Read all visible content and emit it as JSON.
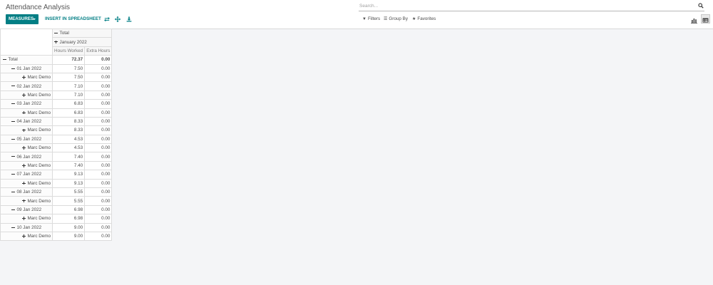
{
  "app": {
    "title": "Attendance Analysis",
    "search_placeholder": "Search..."
  },
  "toolbar": {
    "measures_label": "MEASURES",
    "spreadsheet_label": "INSERT IN SPREADSHEET",
    "icons": [
      "flip-axis-icon",
      "expand-all-icon",
      "download-icon"
    ]
  },
  "filters": {
    "filters_label": "Filters",
    "group_by_label": "Group By",
    "favorites_label": "Favorites"
  },
  "views": [
    {
      "name": "graph-view-icon",
      "active": false
    },
    {
      "name": "pivot-view-icon",
      "active": true
    }
  ],
  "pivot": {
    "col_total_label": "Total",
    "col_group_label": "January 2022",
    "measures": [
      "Hours Worked",
      "Extra Hours"
    ],
    "rows": [
      {
        "label": "Total",
        "level": 0,
        "sign": "minus",
        "hours": "72.37",
        "extra": "0.00",
        "total": true
      },
      {
        "label": "01 Jan 2022",
        "level": 1,
        "sign": "minus",
        "hours": "7.50",
        "extra": "0.00"
      },
      {
        "label": "Marc Demo",
        "level": 2,
        "sign": "plus",
        "hours": "7.50",
        "extra": "0.00"
      },
      {
        "label": "02 Jan 2022",
        "level": 1,
        "sign": "minus",
        "hours": "7.10",
        "extra": "0.00"
      },
      {
        "label": "Marc Demo",
        "level": 2,
        "sign": "plus",
        "hours": "7.10",
        "extra": "0.00"
      },
      {
        "label": "03 Jan 2022",
        "level": 1,
        "sign": "minus",
        "hours": "6.83",
        "extra": "0.00"
      },
      {
        "label": "Marc Demo",
        "level": 2,
        "sign": "plus",
        "hours": "6.83",
        "extra": "0.00"
      },
      {
        "label": "04 Jan 2022",
        "level": 1,
        "sign": "minus",
        "hours": "8.33",
        "extra": "0.00"
      },
      {
        "label": "Marc Demo",
        "level": 2,
        "sign": "plus",
        "hours": "8.33",
        "extra": "0.00"
      },
      {
        "label": "05 Jan 2022",
        "level": 1,
        "sign": "minus",
        "hours": "4.53",
        "extra": "0.00"
      },
      {
        "label": "Marc Demo",
        "level": 2,
        "sign": "plus",
        "hours": "4.53",
        "extra": "0.00"
      },
      {
        "label": "06 Jan 2022",
        "level": 1,
        "sign": "minus",
        "hours": "7.40",
        "extra": "0.00"
      },
      {
        "label": "Marc Demo",
        "level": 2,
        "sign": "plus",
        "hours": "7.40",
        "extra": "0.00"
      },
      {
        "label": "07 Jan 2022",
        "level": 1,
        "sign": "minus",
        "hours": "9.13",
        "extra": "0.00"
      },
      {
        "label": "Marc Demo",
        "level": 2,
        "sign": "plus",
        "hours": "9.13",
        "extra": "0.00"
      },
      {
        "label": "08 Jan 2022",
        "level": 1,
        "sign": "minus",
        "hours": "5.55",
        "extra": "0.00"
      },
      {
        "label": "Marc Demo",
        "level": 2,
        "sign": "plus",
        "hours": "5.55",
        "extra": "0.00"
      },
      {
        "label": "09 Jan 2022",
        "level": 1,
        "sign": "minus",
        "hours": "6.98",
        "extra": "0.00"
      },
      {
        "label": "Marc Demo",
        "level": 2,
        "sign": "plus",
        "hours": "6.98",
        "extra": "0.00"
      },
      {
        "label": "10 Jan 2022",
        "level": 1,
        "sign": "minus",
        "hours": "9.00",
        "extra": "0.00"
      },
      {
        "label": "Marc Demo",
        "level": 2,
        "sign": "plus",
        "hours": "9.00",
        "extra": "0.00"
      }
    ]
  },
  "colors": {
    "accent": "#017e84",
    "background": "#f4f5f7"
  }
}
